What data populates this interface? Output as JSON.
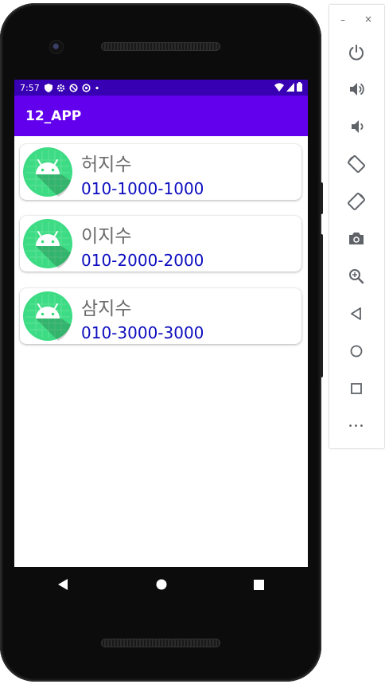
{
  "status_bar": {
    "time": "7:57"
  },
  "app_bar": {
    "title": "12_APP"
  },
  "contacts": [
    {
      "name": "허지수",
      "phone": "010-1000-1000"
    },
    {
      "name": "이지수",
      "phone": "010-2000-2000"
    },
    {
      "name": "삼지수",
      "phone": "010-3000-3000"
    }
  ],
  "colors": {
    "status_bar": "#3700B3",
    "app_bar": "#6200EE",
    "name_text": "#6b6b6b",
    "phone_text": "#0d0dbf",
    "avatar_bg": "#3ddc84"
  },
  "emulator_toolbar": {
    "window_minimize": "–",
    "window_close": "×",
    "more": "•••",
    "buttons": [
      "power-icon",
      "volume-up-icon",
      "volume-down-icon",
      "rotate-left-icon",
      "rotate-right-icon",
      "camera-icon",
      "zoom-icon",
      "back-icon",
      "home-icon",
      "overview-icon",
      "more-icon"
    ]
  }
}
